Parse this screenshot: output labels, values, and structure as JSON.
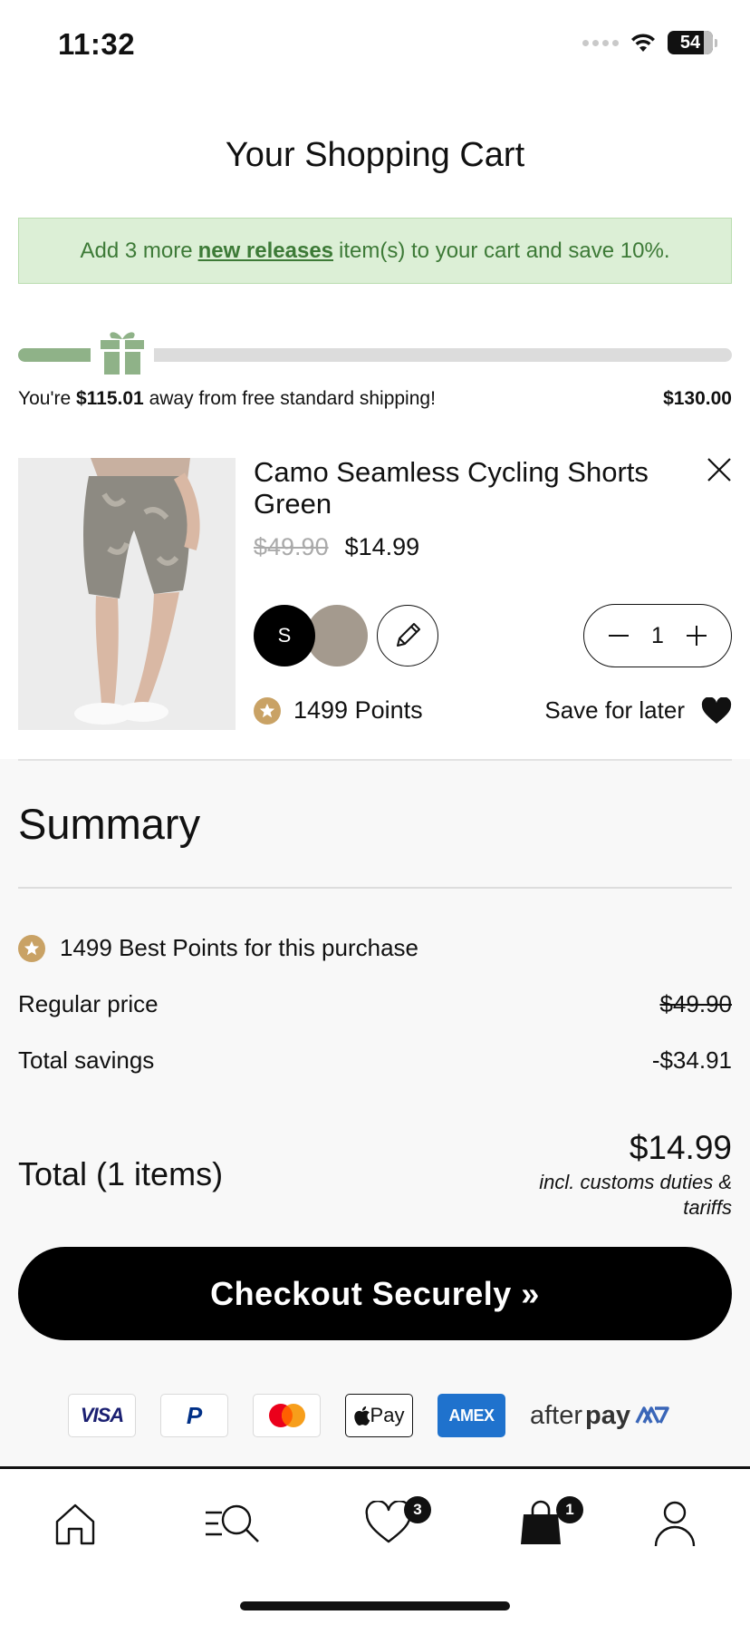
{
  "status_bar": {
    "time": "11:32",
    "battery": "54"
  },
  "page_title": "Your Shopping Cart",
  "promo": {
    "prefix": "Add 3 more",
    "link": "new releases",
    "suffix": "item(s) to your cart and save 10%."
  },
  "shipping": {
    "prefix": "You're",
    "amount": "$115.01",
    "suffix": "away from free standard shipping!",
    "target": "$130.00",
    "progress": 0.115
  },
  "cart_item": {
    "name": "Camo Seamless Cycling Shorts Green",
    "price_original": "$49.90",
    "price_sale": "$14.99",
    "size": "S",
    "color_hex": "#a49a8e",
    "quantity": "1",
    "points": "1499 Points",
    "save_for_later": "Save for later"
  },
  "summary": {
    "title": "Summary",
    "points_text": "1499 Best Points for this purchase",
    "regular_label": "Regular price",
    "regular_value": "$49.90",
    "savings_label": "Total savings",
    "savings_value": "-$34.91",
    "total_label": "Total (1 items)",
    "total_value": "$14.99",
    "total_note": "incl. customs duties & tariffs",
    "checkout_label": "Checkout Securely »"
  },
  "payments": {
    "visa": "VISA",
    "paypal": "P",
    "applepay": "Pay",
    "amex": "AMEX",
    "afterpay_light": "after",
    "afterpay_bold": "pay"
  },
  "tab_bar": {
    "wishlist_count": "3",
    "bag_count": "1"
  },
  "colors": {
    "promo_bg": "#dcefd6",
    "promo_text": "#3d7a37",
    "progress_fill": "#8fb288",
    "coin": "#c9a265",
    "amex": "#1f72cd"
  }
}
